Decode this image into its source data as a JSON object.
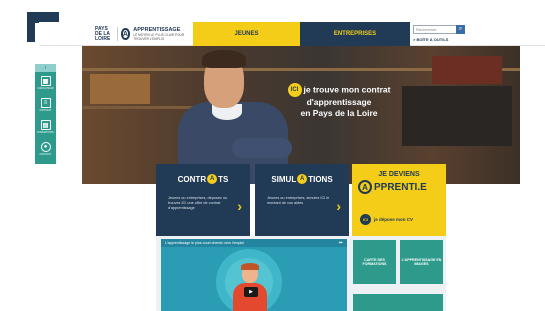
{
  "header": {
    "region_logo_text": "PAYS DE LA LOIRE",
    "brand_name": "APPRENTISSAGE",
    "brand_tagline": "LE MOYEN LE PLUS CLAIR POUR TROUVER L'EMPLOI",
    "tabs": [
      {
        "label": "JEUNES"
      },
      {
        "label": "ENTREPRISES"
      }
    ],
    "search_placeholder": "Rechercher",
    "toolbox_label": "> BOÎTE À OUTILS"
  },
  "toolbar": {
    "collapse_glyph": "‹",
    "items": [
      {
        "label": "SIMULATEUR",
        "icon": "calculator-icon"
      },
      {
        "label": "CONTRAT",
        "icon": "document-icon"
      },
      {
        "label": "FORMATIONS",
        "icon": "book-icon"
      },
      {
        "label": "CONTACT",
        "icon": "person-icon"
      }
    ]
  },
  "hero": {
    "badge": "ICI",
    "line1": "je trouve mon contrat",
    "line2": "d'apprentissage",
    "line3": "en Pays de la Loire"
  },
  "cards": {
    "contrats": {
      "title_pre": "CONTR",
      "title_post": "TS",
      "desc": "Jeunes ou entreprises, déposez ou trouvez ICI une offre de contrat d'apprentissage"
    },
    "simulations": {
      "title_pre": "SIMUL",
      "title_post": "TIONS",
      "desc": "Jeunes ou entreprises, simulez ICI le montant de vos aides"
    },
    "deviens": {
      "line1": "JE DEVIENS",
      "line2": "PPRENTI.E",
      "cv_badge": "ICI",
      "cv_text": "je dépose mon CV"
    }
  },
  "video": {
    "title": "L'apprentissage le plus court chemin vers l'emploi",
    "share_glyph": "➦"
  },
  "tiles": [
    {
      "label": "CARTE DES FORMATIONS"
    },
    {
      "label": "L'APPRENTISSAGE EN IMAGES"
    }
  ],
  "colors": {
    "navy": "#213a55",
    "yellow": "#f3cd18",
    "teal": "#2e9a8c"
  }
}
